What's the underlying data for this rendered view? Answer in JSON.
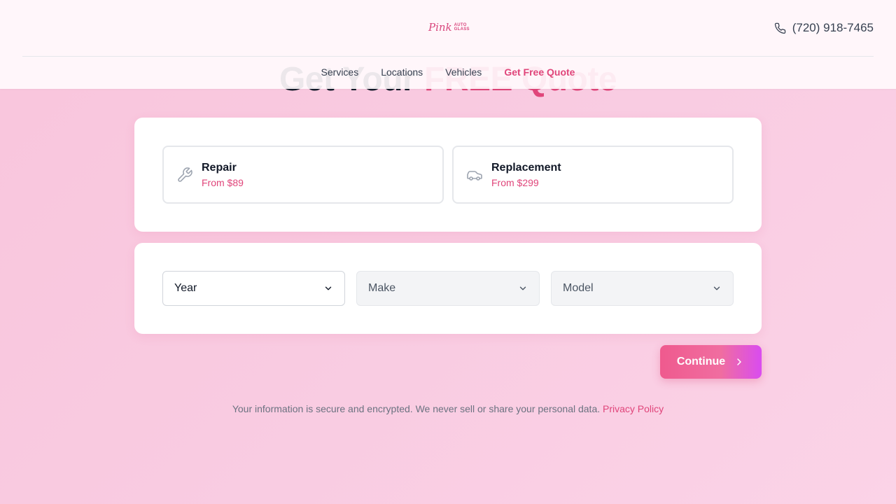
{
  "hero": {
    "title_main": "Get Your",
    "title_accent": "FREE Quote"
  },
  "header": {
    "logo": {
      "script": "Pink",
      "line1": "AUTO",
      "line2": "GLASS"
    },
    "phone": "(720) 918-7465",
    "nav": [
      {
        "label": "Services"
      },
      {
        "label": "Locations"
      },
      {
        "label": "Vehicles"
      },
      {
        "label": "Get Free Quote"
      }
    ]
  },
  "services": [
    {
      "name": "Repair",
      "price": "From $89",
      "icon": "wrench-icon"
    },
    {
      "name": "Replacement",
      "price": "From $299",
      "icon": "car-icon"
    }
  ],
  "vehicle": {
    "year_placeholder": "Year",
    "make_placeholder": "Make",
    "model_placeholder": "Model"
  },
  "continue_label": "Continue",
  "footer": {
    "note": "Your information is secure and encrypted. We never sell or share your personal data.",
    "privacy_link": "Privacy Policy"
  },
  "colors": {
    "accent": "#e0457a",
    "background": "#f9c8df"
  }
}
